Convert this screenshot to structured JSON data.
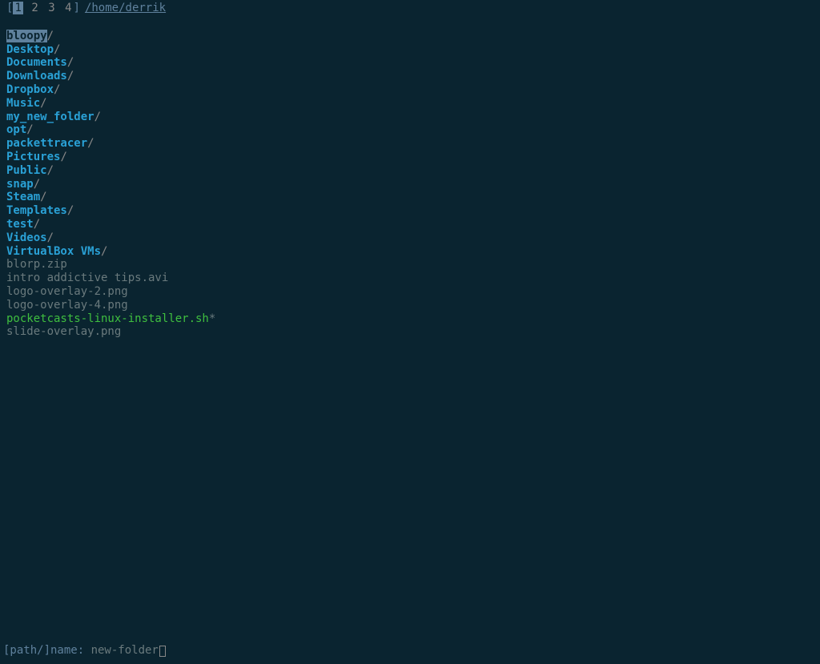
{
  "header": {
    "bracket_open": "[",
    "bracket_close": "]",
    "tabs": [
      "1",
      "2",
      "3",
      "4"
    ],
    "active_tab_index": 0,
    "cwd": "/home/derrik"
  },
  "listing": [
    {
      "name": "bloopy",
      "type": "dir",
      "selected": true
    },
    {
      "name": "Desktop",
      "type": "dir",
      "selected": false
    },
    {
      "name": "Documents",
      "type": "dir",
      "selected": false
    },
    {
      "name": "Downloads",
      "type": "dir",
      "selected": false
    },
    {
      "name": "Dropbox",
      "type": "dir",
      "selected": false
    },
    {
      "name": "Music",
      "type": "dir",
      "selected": false
    },
    {
      "name": "my_new_folder",
      "type": "dir",
      "selected": false
    },
    {
      "name": "opt",
      "type": "dir",
      "selected": false
    },
    {
      "name": "packettracer",
      "type": "dir",
      "selected": false
    },
    {
      "name": "Pictures",
      "type": "dir",
      "selected": false
    },
    {
      "name": "Public",
      "type": "dir",
      "selected": false
    },
    {
      "name": "snap",
      "type": "dir",
      "selected": false
    },
    {
      "name": "Steam",
      "type": "dir",
      "selected": false
    },
    {
      "name": "Templates",
      "type": "dir",
      "selected": false
    },
    {
      "name": "test",
      "type": "dir",
      "selected": false
    },
    {
      "name": "Videos",
      "type": "dir",
      "selected": false
    },
    {
      "name": "VirtualBox VMs",
      "type": "dir",
      "selected": false
    },
    {
      "name": "blorp.zip",
      "type": "file",
      "selected": false
    },
    {
      "name": "intro addictive tips.avi",
      "type": "file",
      "selected": false
    },
    {
      "name": "logo-overlay-2.png",
      "type": "file",
      "selected": false
    },
    {
      "name": "logo-overlay-4.png",
      "type": "file",
      "selected": false
    },
    {
      "name": "pocketcasts-linux-installer.sh",
      "type": "exec",
      "selected": false
    },
    {
      "name": "slide-overlay.png",
      "type": "file",
      "selected": false
    }
  ],
  "suffixes": {
    "dir": "/",
    "exec": "*"
  },
  "prompt": {
    "label": "[path/]name: ",
    "value": "new-folder"
  }
}
